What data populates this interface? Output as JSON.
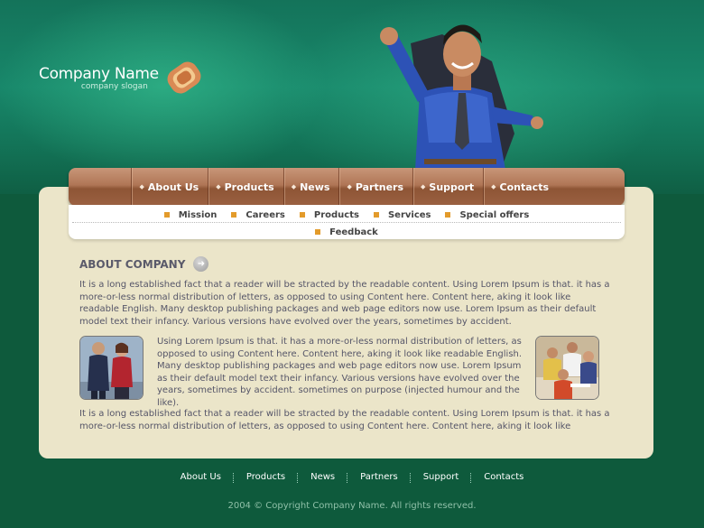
{
  "header": {
    "company_name": "Company Name",
    "company_slogan": "company slogan"
  },
  "main_menu": [
    {
      "label": "About Us"
    },
    {
      "label": "Products"
    },
    {
      "label": "News"
    },
    {
      "label": "Partners"
    },
    {
      "label": "Support"
    },
    {
      "label": "Contacts"
    }
  ],
  "sub_menu": {
    "row1": [
      "Mission",
      "Careers",
      "Products",
      "Services",
      "Special offers"
    ],
    "row2": [
      "Feedback"
    ]
  },
  "about": {
    "title": "ABOUT COMPANY",
    "para1": "It is a long established fact that a reader will be stracted by the readable content. Using Lorem Ipsum is that. it has a more-or-less normal distribution of letters, as opposed to using Content here. Content here, aking it look like readable English. Many desktop publishing packages and web page editors now use. Lorem Ipsum as their default model text their infancy. Various versions have evolved over the years, sometimes by accident.",
    "para2": "Using Lorem Ipsum is that. it has a more-or-less normal distribution of letters, as opposed to using Content here. Content here, aking it look like readable English. Many desktop publishing packages and web page editors now use. Lorem Ipsum as their default model text their infancy. Various versions have evolved over the years, sometimes by accident. sometimes on purpose (injected humour and the like).",
    "para3": "It is a long established fact that a reader will be stracted by the readable content. Using Lorem Ipsum is that. it has a more-or-less normal distribution of letters, as opposed to using Content here. Content here, aking it look like readable"
  },
  "footer": {
    "links": [
      "About Us",
      "Products",
      "News",
      "Partners",
      "Support",
      "Contacts"
    ],
    "copyright": "2004 © Copyright Company Name. All rights reserved."
  },
  "colors": {
    "background": "#0e5a3c",
    "panel": "#ebe5c9",
    "menu_brown": "#a96f4f",
    "bullet_orange": "#e39b2b",
    "text": "#555568"
  }
}
